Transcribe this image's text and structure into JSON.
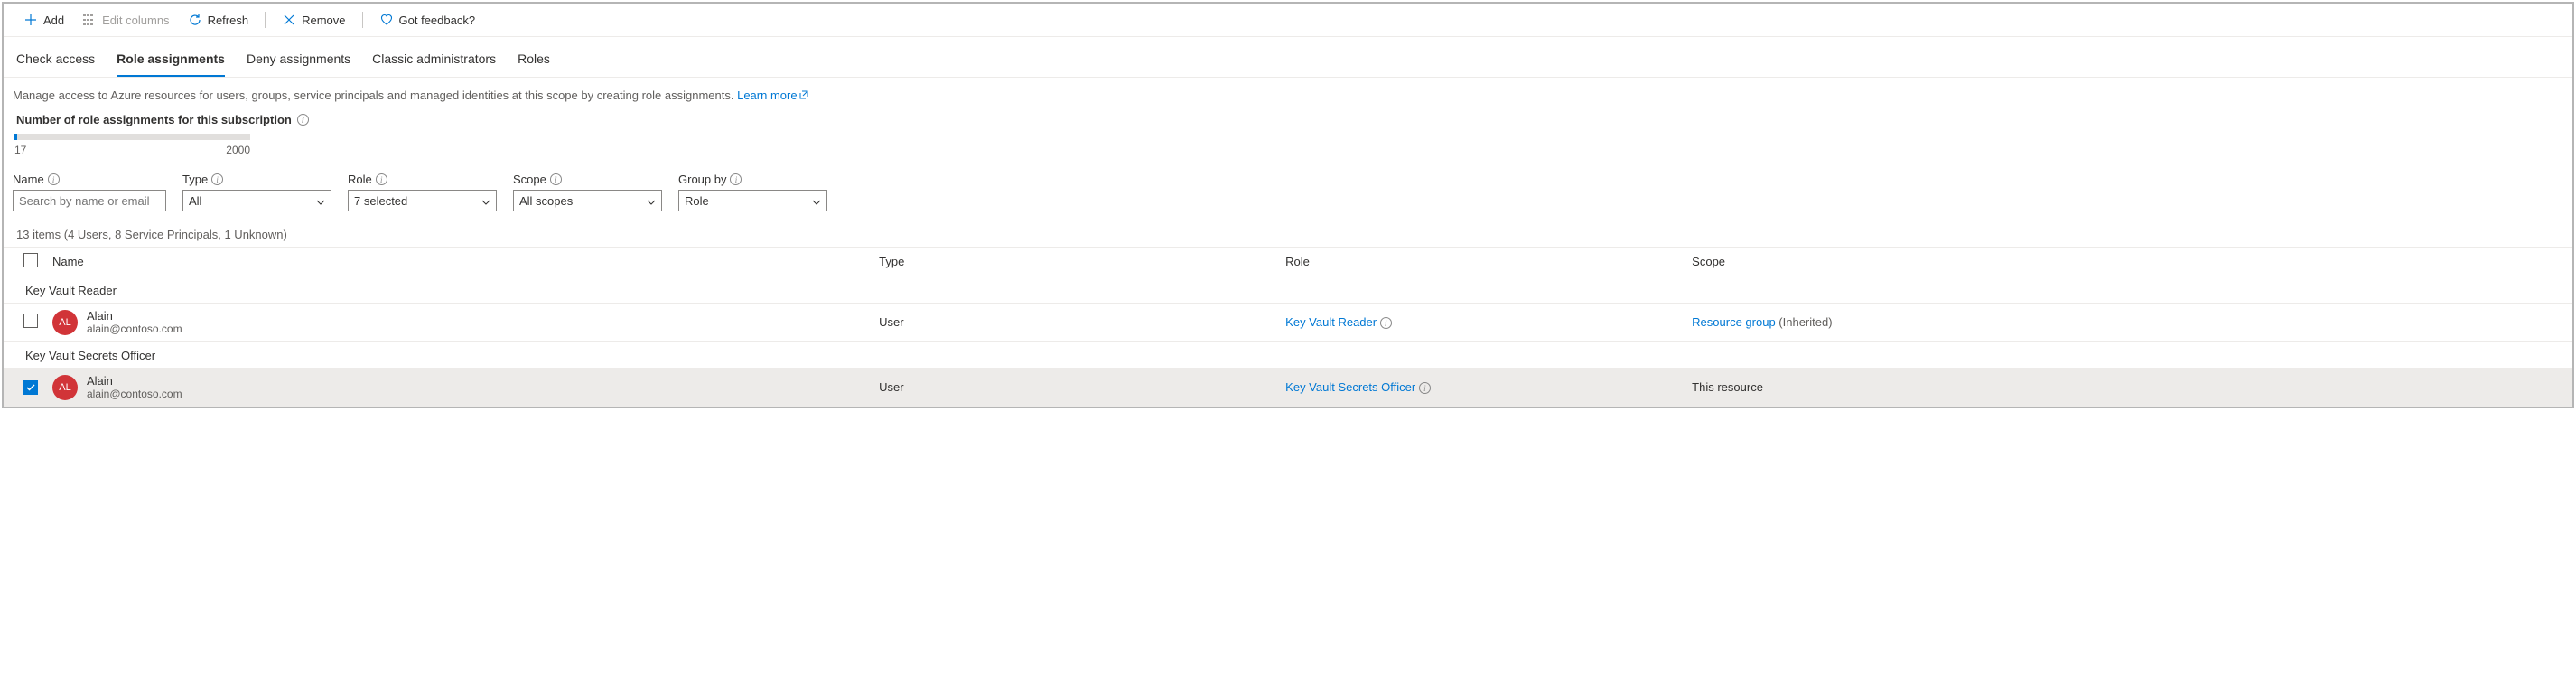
{
  "toolbar": {
    "add": "Add",
    "edit_columns": "Edit columns",
    "refresh": "Refresh",
    "remove": "Remove",
    "feedback": "Got feedback?"
  },
  "tabs": {
    "check_access": "Check access",
    "role_assignments": "Role assignments",
    "deny_assignments": "Deny assignments",
    "classic_admins": "Classic administrators",
    "roles": "Roles"
  },
  "description": "Manage access to Azure resources for users, groups, service principals and managed identities at this scope by creating role assignments.",
  "learn_more": "Learn more",
  "count_label": "Number of role assignments for this subscription",
  "gauge": {
    "current": "17",
    "max": "2000"
  },
  "filters": {
    "name_label": "Name",
    "name_placeholder": "Search by name or email",
    "type_label": "Type",
    "type_value": "All",
    "role_label": "Role",
    "role_value": "7 selected",
    "scope_label": "Scope",
    "scope_value": "All scopes",
    "groupby_label": "Group by",
    "groupby_value": "Role"
  },
  "items_summary": "13 items (4 Users, 8 Service Principals, 1 Unknown)",
  "headers": {
    "name": "Name",
    "type": "Type",
    "role": "Role",
    "scope": "Scope"
  },
  "groups": [
    {
      "title": "Key Vault Reader",
      "rows": [
        {
          "selected": false,
          "avatar": "AL",
          "name": "Alain",
          "email": "alain@contoso.com",
          "type": "User",
          "role": "Key Vault Reader",
          "scope_link": "Resource group",
          "scope_suffix": "(Inherited)"
        }
      ]
    },
    {
      "title": "Key Vault Secrets Officer",
      "rows": [
        {
          "selected": true,
          "avatar": "AL",
          "name": "Alain",
          "email": "alain@contoso.com",
          "type": "User",
          "role": "Key Vault Secrets Officer",
          "scope_text": "This resource"
        }
      ]
    }
  ]
}
